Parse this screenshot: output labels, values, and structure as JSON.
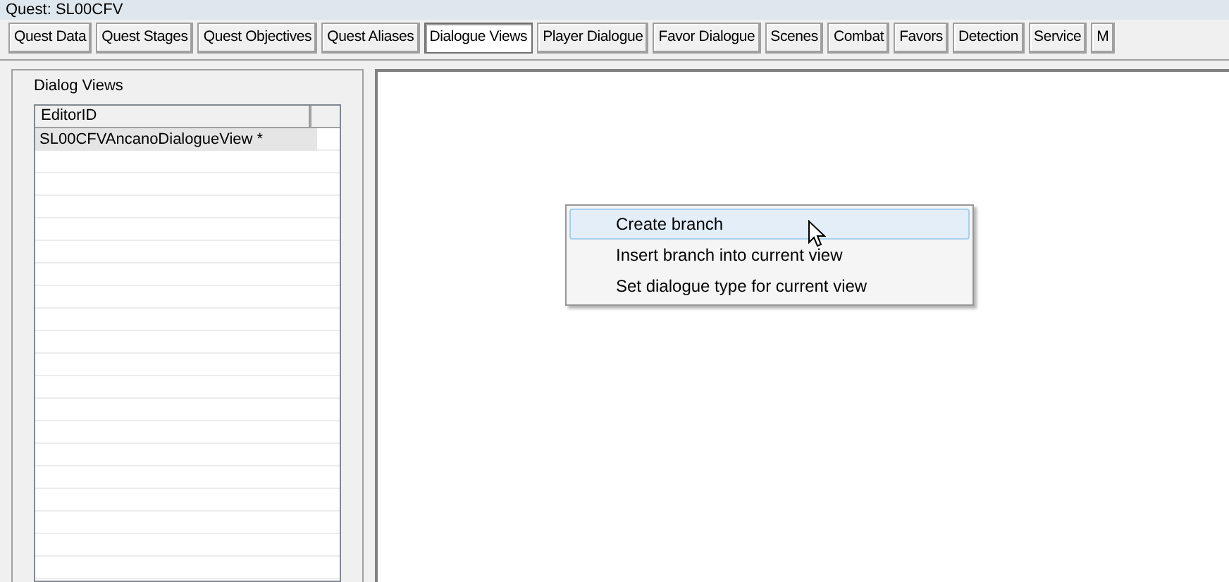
{
  "window": {
    "title": "Quest: SL00CFV"
  },
  "tabs": [
    {
      "label": "Quest Data",
      "selected": false
    },
    {
      "label": "Quest Stages",
      "selected": false
    },
    {
      "label": "Quest Objectives",
      "selected": false
    },
    {
      "label": "Quest Aliases",
      "selected": false
    },
    {
      "label": "Dialogue Views",
      "selected": true
    },
    {
      "label": "Player Dialogue",
      "selected": false
    },
    {
      "label": "Favor Dialogue",
      "selected": false
    },
    {
      "label": "Scenes",
      "selected": false
    },
    {
      "label": "Combat",
      "selected": false
    },
    {
      "label": "Favors",
      "selected": false
    },
    {
      "label": "Detection",
      "selected": false
    },
    {
      "label": "Service",
      "selected": false
    },
    {
      "label": "M",
      "selected": false
    }
  ],
  "dialog_views": {
    "label": "Dialog Views",
    "columns": [
      "EditorID"
    ],
    "rows": [
      {
        "editor_id": "SL00CFVAncanoDialogueView *",
        "selected": true
      }
    ]
  },
  "context_menu": {
    "items": [
      {
        "label": "Create branch",
        "selected": true
      },
      {
        "label": "Insert branch into current view",
        "selected": false
      },
      {
        "label": "Set dialogue type for current view",
        "selected": false
      }
    ]
  }
}
